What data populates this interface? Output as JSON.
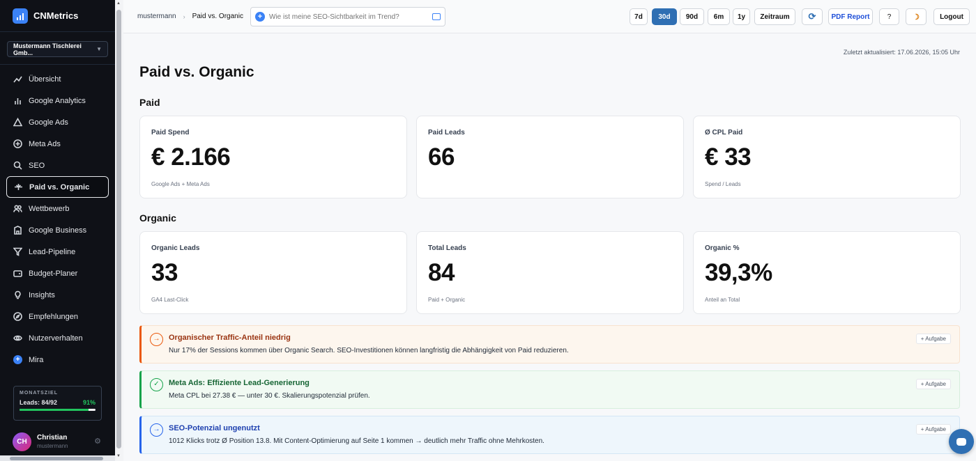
{
  "brand": {
    "name": "CNMetrics"
  },
  "account": {
    "name": "Mustermann Tischlerei Gmb..."
  },
  "nav": [
    {
      "label": "Übersicht",
      "icon": "line-chart-icon"
    },
    {
      "label": "Google Analytics",
      "icon": "bar-chart-icon"
    },
    {
      "label": "Google Ads",
      "icon": "triangle-icon"
    },
    {
      "label": "Meta Ads",
      "icon": "plus-circle-icon"
    },
    {
      "label": "SEO",
      "icon": "search-icon"
    },
    {
      "label": "Paid vs. Organic",
      "icon": "split-icon",
      "active": true
    },
    {
      "label": "Wettbewerb",
      "icon": "users-icon"
    },
    {
      "label": "Google Business",
      "icon": "building-icon"
    },
    {
      "label": "Lead-Pipeline",
      "icon": "funnel-icon"
    },
    {
      "label": "Budget-Planer",
      "icon": "wallet-icon"
    },
    {
      "label": "Insights",
      "icon": "bulb-icon"
    },
    {
      "label": "Empfehlungen",
      "icon": "compass-icon"
    },
    {
      "label": "Nutzerverhalten",
      "icon": "eye-icon"
    },
    {
      "label": "Mira",
      "icon": "mira-icon"
    }
  ],
  "goal": {
    "label": "MONATSZIEL",
    "leads": "Leads: 84/92",
    "pct": "91%",
    "fraction": 0.91
  },
  "user": {
    "initials": "CH",
    "name": "Christian",
    "sub": "mustermann"
  },
  "topbar": {
    "crumb_root": "mustermann",
    "crumb_current": "Paid vs. Organic",
    "ask_placeholder": "Wie ist meine SEO-Sichtbarkeit im Trend?",
    "ranges": [
      "7d",
      "30d",
      "90d",
      "6m",
      "1y",
      "Zeitraum"
    ],
    "active_range": "30d",
    "pdf": "PDF Report",
    "help": "?",
    "logout": "Logout"
  },
  "page": {
    "updated": "Zuletzt aktualisiert: 17.06.2026, 15:05 Uhr",
    "title": "Paid vs. Organic",
    "paid_heading": "Paid",
    "organic_heading": "Organic"
  },
  "paid_cards": [
    {
      "label": "Paid Spend",
      "value": "€ 2.166",
      "hint": "Google Ads + Meta Ads"
    },
    {
      "label": "Paid Leads",
      "value": "66",
      "hint": ""
    },
    {
      "label": "Ø CPL Paid",
      "value": "€ 33",
      "hint": "Spend / Leads"
    }
  ],
  "organic_cards": [
    {
      "label": "Organic Leads",
      "value": "33",
      "hint": "GA4 Last-Click"
    },
    {
      "label": "Total Leads",
      "value": "84",
      "hint": "Paid + Organic"
    },
    {
      "label": "Organic %",
      "value": "39,3%",
      "hint": "Anteil an Total"
    }
  ],
  "alerts": [
    {
      "type": "warn",
      "icon": "→",
      "title": "Organischer Traffic-Anteil niedrig",
      "text": "Nur 17% der Sessions kommen über Organic Search. SEO-Investitionen können langfristig die Abhängigkeit von Paid reduzieren.",
      "task": "+ Aufgabe"
    },
    {
      "type": "ok",
      "icon": "✓",
      "title": "Meta Ads: Effiziente Lead-Generierung",
      "text": "Meta CPL bei 27.38 € — unter 30 €. Skalierungspotenzial prüfen.",
      "task": "+ Aufgabe"
    },
    {
      "type": "info",
      "icon": "→",
      "title": "SEO-Potenzial ungenutzt",
      "text": "1012 Klicks trotz Ø Position 13.8. Mit Content-Optimierung auf Seite 1 kommen → deutlich mehr Traffic ohne Mehrkosten.",
      "task": "+ Aufgabe"
    }
  ]
}
